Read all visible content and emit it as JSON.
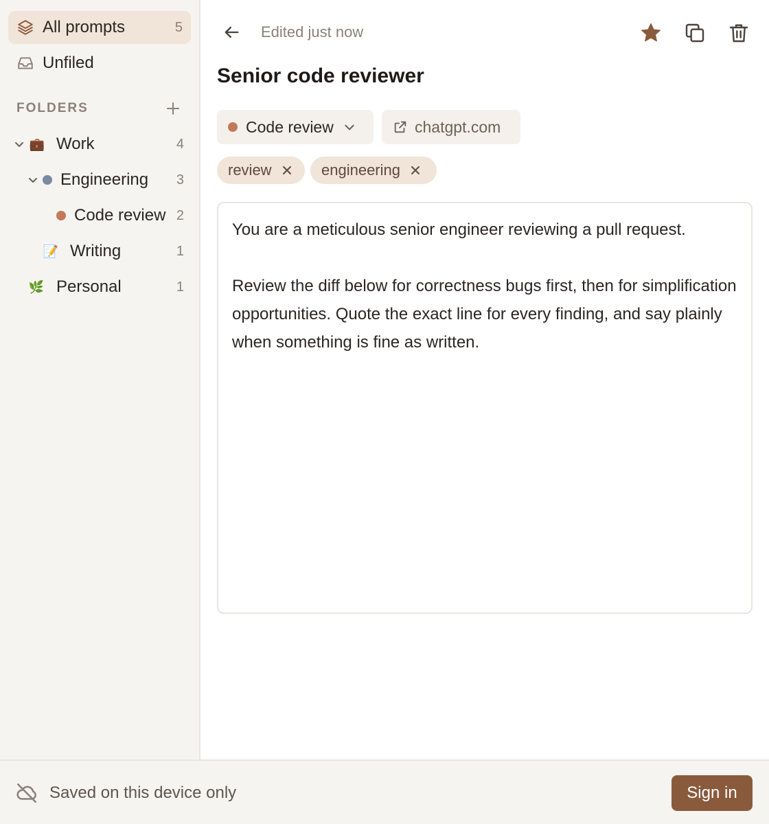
{
  "sidebar": {
    "all_prompts": {
      "label": "All prompts",
      "count": "5",
      "icon": "layers-icon"
    },
    "unfiled": {
      "label": "Unfiled",
      "icon": "inbox-icon"
    },
    "folders_label": "FOLDERS",
    "tree": [
      {
        "label": "Work",
        "count": "4",
        "icon": "💼"
      },
      {
        "label": "Engineering",
        "count": "3",
        "dot_color": "#7b8aa3"
      },
      {
        "label": "Code review",
        "count": "2",
        "dot_color": "#c27a5a"
      },
      {
        "label": "Writing",
        "count": "1",
        "icon": "📝"
      },
      {
        "label": "Personal",
        "count": "1",
        "icon": "🌿"
      }
    ]
  },
  "header": {
    "edited": "Edited just now",
    "starred": true
  },
  "prompt": {
    "title": "Senior code reviewer",
    "folder": {
      "label": "Code review",
      "dot_color": "#c27a5a"
    },
    "site": "chatgpt.com",
    "tags": [
      "review",
      "engineering"
    ],
    "body": "You are a meticulous senior engineer reviewing a pull request.\n\nReview the diff below for correctness bugs first, then for simplification opportunities. Quote the exact line for every finding, and say plainly when something is fine as written."
  },
  "footer": {
    "status": "Saved on this device only",
    "signin_label": "Sign in"
  },
  "colors": {
    "accent": "#8a5a3c",
    "active_bg": "#f1e4d8",
    "sidebar_bg": "#f6f4f0"
  }
}
